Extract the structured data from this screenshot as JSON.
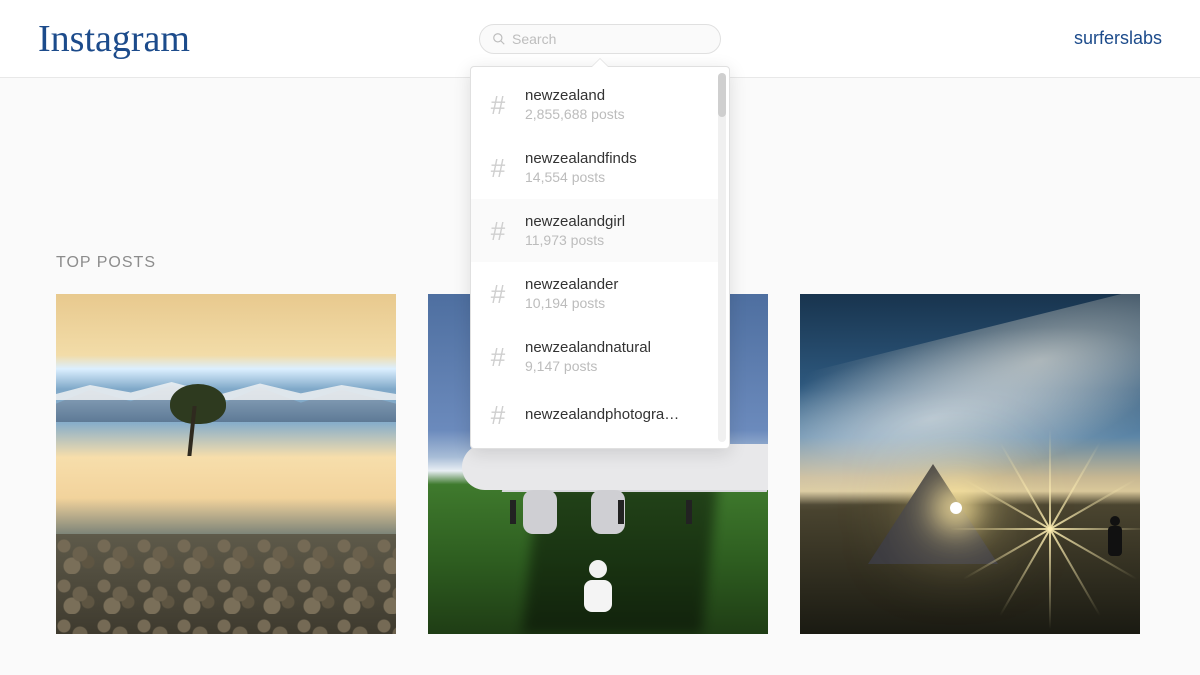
{
  "header": {
    "logo": "Instagram",
    "search_placeholder": "Search",
    "user": "surferslabs"
  },
  "dropdown": {
    "items": [
      {
        "tag": "newzealand",
        "count": "2,855,688 posts"
      },
      {
        "tag": "newzealandfinds",
        "count": "14,554 posts"
      },
      {
        "tag": "newzealandgirl",
        "count": "11,973 posts"
      },
      {
        "tag": "newzealander",
        "count": "10,194 posts"
      },
      {
        "tag": "newzealandnatural",
        "count": "9,147 posts"
      },
      {
        "tag": "newzealandphotogra…",
        "count": ""
      }
    ]
  },
  "content": {
    "section_title": "TOP POSTS"
  }
}
